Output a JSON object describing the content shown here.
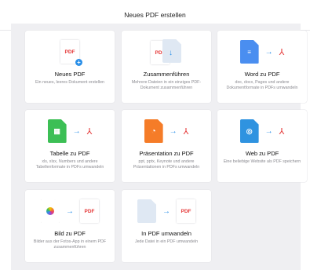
{
  "header": {
    "title": "Neues PDF erstellen"
  },
  "cards": [
    {
      "title": "Neues PDF",
      "desc": "Ein neues, leeres Dokument erstellen",
      "pdf_label": "PDF"
    },
    {
      "title": "Zusammenführen",
      "desc": "Mehrere Dateien in ein einziges PDF-Dokument zusammenführen",
      "pdf_label": "PDF"
    },
    {
      "title": "Word zu PDF",
      "desc": "doc, docx, Pages und andere Dokumentformate in PDFs umwandeln"
    },
    {
      "title": "Tabelle zu PDF",
      "desc": "xls, xlsx, Numbers und andere Tabellenformate in PDFs umwandeln"
    },
    {
      "title": "Präsentation zu PDF",
      "desc": "ppt, pptx, Keynote und andere Präsentationen in PDFs umwandeln"
    },
    {
      "title": "Web zu PDF",
      "desc": "Eine beliebige Website als PDF speichern"
    },
    {
      "title": "Bild zu PDF",
      "desc": "Bilder aus der Fotos-App in einem PDF zusammenführen",
      "pdf_label": "PDF"
    },
    {
      "title": "In PDF umwandeln",
      "desc": "Jede Datei in ein PDF umwandeln",
      "pdf_label": "PDF"
    }
  ],
  "colors": {
    "accent": "#2a8fe8",
    "pdf_red": "#e53a3a",
    "word_blue": "#4a8ef0",
    "sheet_green": "#3cbf55",
    "slides_orange": "#f57c28",
    "web_blue": "#2f93e0"
  },
  "icons": [
    "pdf-new-icon",
    "merge-icon",
    "word-doc-icon",
    "spreadsheet-icon",
    "presentation-icon",
    "web-icon",
    "photos-icon",
    "file-icon",
    "arrow-right-icon",
    "acrobat-icon"
  ]
}
